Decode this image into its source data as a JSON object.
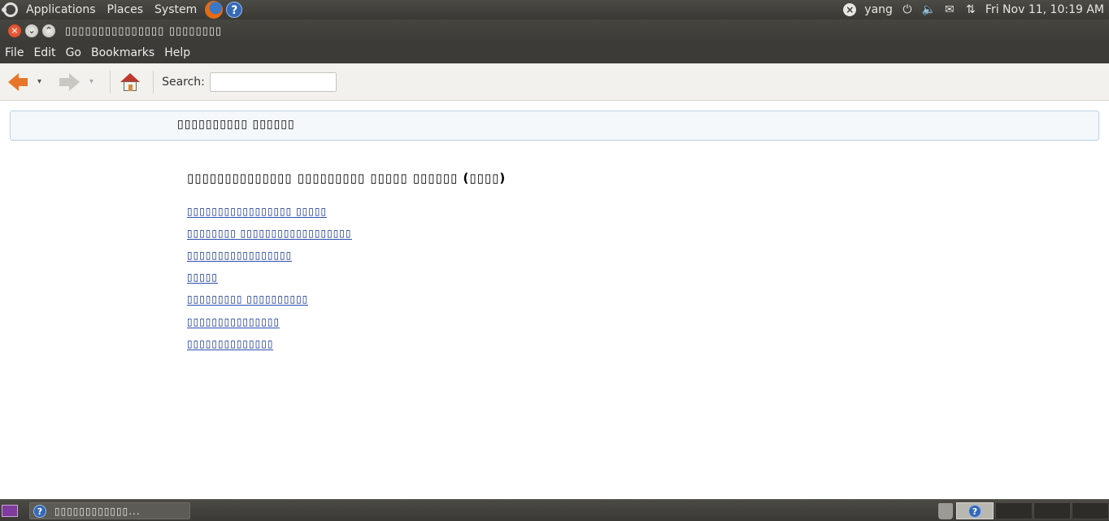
{
  "top_panel": {
    "menus": [
      "Applications",
      "Places",
      "System"
    ],
    "user": "yang",
    "clock": "Fri Nov 11, 10:19 AM",
    "icons": [
      "ubuntu-logo-icon",
      "firefox-icon",
      "help-icon",
      "user-status-icon",
      "power-icon",
      "volume-icon",
      "mail-icon",
      "network-icon"
    ]
  },
  "window": {
    "title": "▯▯▯▯▯▯▯▯▯▯▯▯▯▯▯ ▯▯▯▯▯▯▯▯"
  },
  "menubar": [
    "File",
    "Edit",
    "Go",
    "Bookmarks",
    "Help"
  ],
  "toolbar": {
    "search_label": "Search:",
    "search_value": "",
    "back_dropdown": "▾",
    "forward_dropdown": "▾"
  },
  "content": {
    "header_title": "▯▯▯▯▯▯▯▯▯▯ ▯▯▯▯▯▯",
    "heading": "▯▯▯▯▯▯▯▯▯▯▯▯▯▯ ▯▯▯▯▯▯▯▯▯ ▯▯▯▯▯ ▯▯▯▯▯▯ (▯▯▯▯)",
    "entries": [
      "▯▯▯▯▯▯▯▯▯▯▯▯▯▯▯▯▯ ▯▯▯▯▯",
      "▯▯▯▯▯▯▯▯ ▯▯▯▯▯▯▯▯▯▯▯▯▯▯▯▯▯▯",
      "▯▯▯▯▯▯▯▯▯▯▯▯▯▯▯▯▯",
      "▯▯▯▯▯",
      "▯▯▯▯▯▯▯▯▯ ▯▯▯▯▯▯▯▯▯▯",
      "▯▯▯▯▯▯▯▯▯▯▯▯▯▯▯",
      "▯▯▯▯▯▯▯▯▯▯▯▯▯▯"
    ]
  },
  "bottom_panel": {
    "task_label": "▯▯▯▯▯▯▯▯▯▯▯▯...",
    "workspace_help": "?"
  }
}
